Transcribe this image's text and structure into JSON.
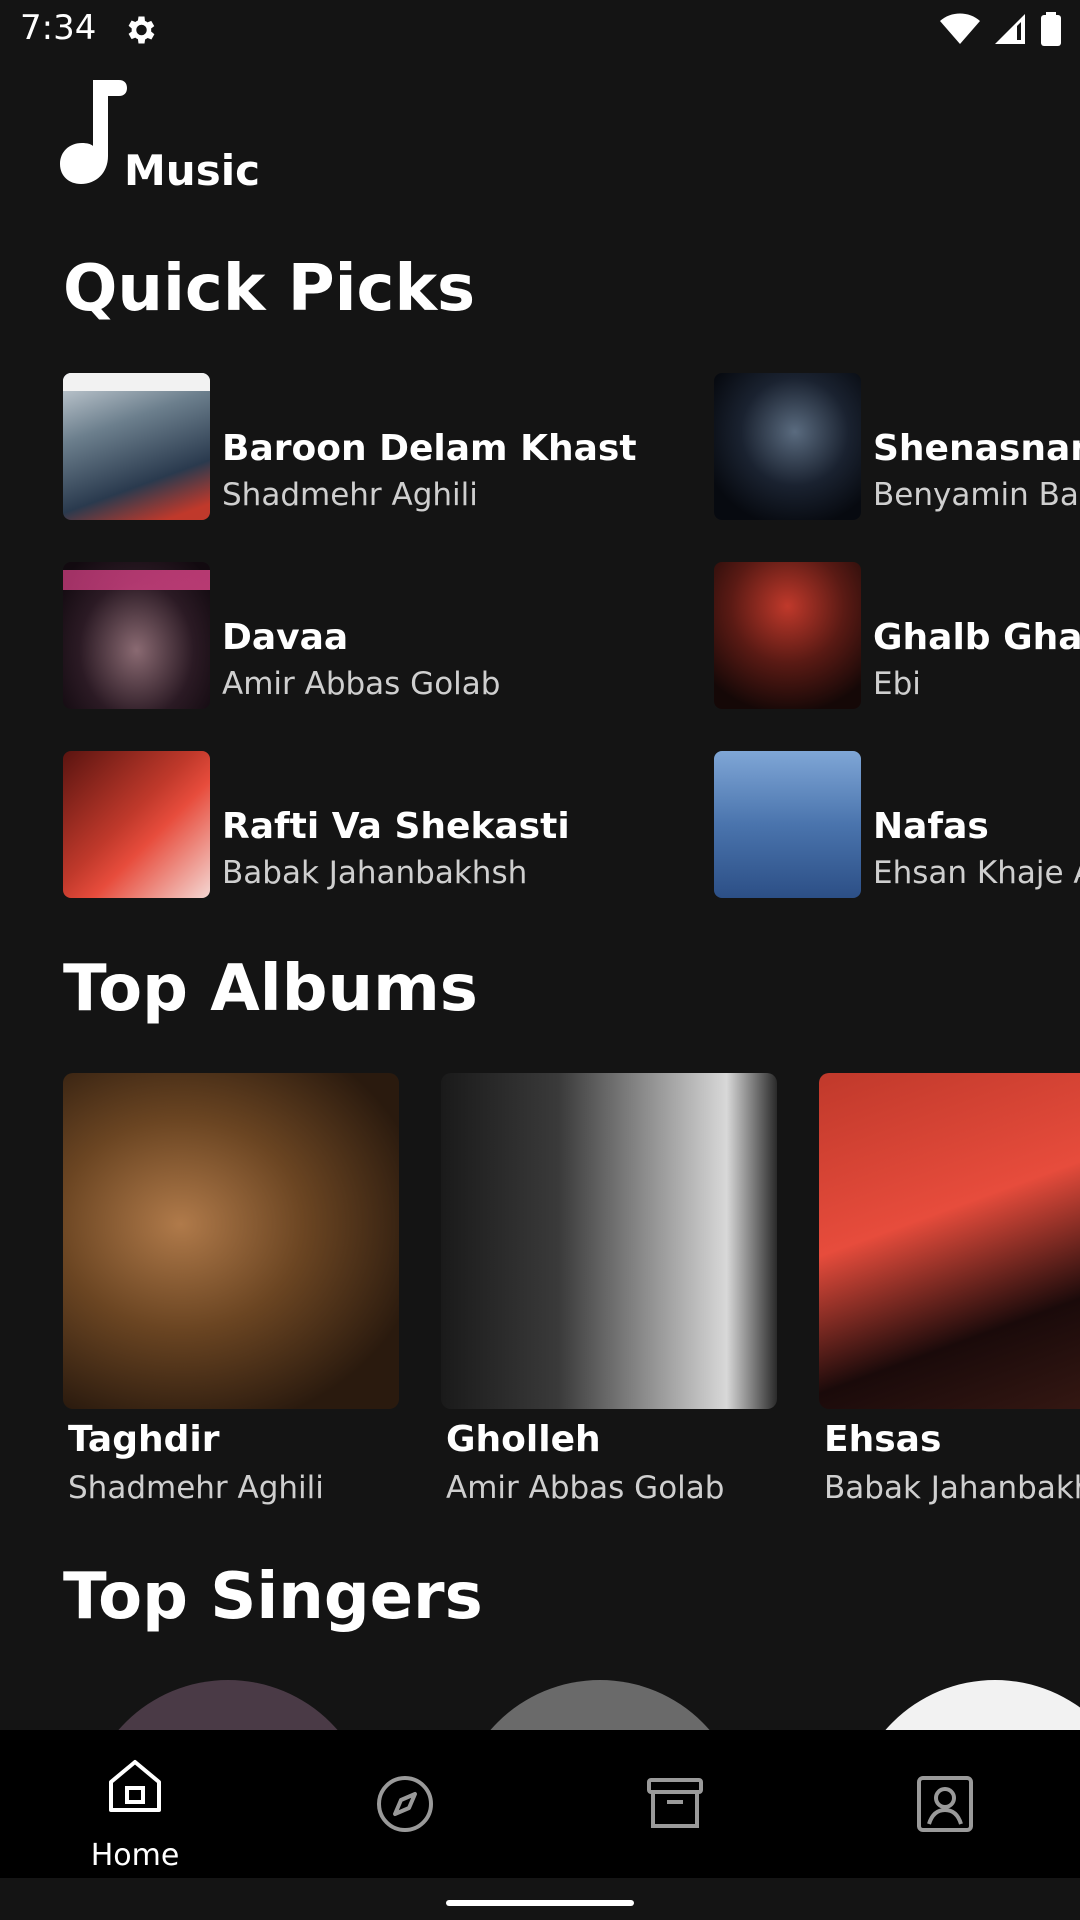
{
  "status_bar": {
    "time": "7:34",
    "icons": [
      "gear-icon",
      "wifi-icon",
      "signal-icon",
      "battery-icon"
    ]
  },
  "app": {
    "logo_icon": "music-note-icon",
    "logo_text": "Music"
  },
  "quick_picks": {
    "title": "Quick Picks",
    "items": [
      {
        "title": "Baroon Delam Khast",
        "artist": "Shadmehr Aghili"
      },
      {
        "title": "Shenasname",
        "artist": "Benyamin Bah"
      },
      {
        "title": "Davaa",
        "artist": "Amir Abbas Golab"
      },
      {
        "title": "Ghalb Ghap",
        "artist": "Ebi"
      },
      {
        "title": "Rafti Va Shekasti",
        "artist": "Babak Jahanbakhsh"
      },
      {
        "title": "Nafas",
        "artist": "Ehsan Khaje A"
      }
    ]
  },
  "top_albums": {
    "title": "Top Albums",
    "items": [
      {
        "title": "Taghdir",
        "artist": "Shadmehr Aghili"
      },
      {
        "title": "Gholleh",
        "artist": "Amir Abbas Golab"
      },
      {
        "title": "Ehsas",
        "artist": "Babak Jahanbakh"
      }
    ]
  },
  "top_singers": {
    "title": "Top Singers"
  },
  "bottom_nav": {
    "items": [
      {
        "icon": "home-icon",
        "label": "Home",
        "active": true
      },
      {
        "icon": "compass-icon",
        "label": "",
        "active": false
      },
      {
        "icon": "archive-icon",
        "label": "",
        "active": false
      },
      {
        "icon": "profile-icon",
        "label": "",
        "active": false
      }
    ]
  },
  "colors": {
    "background": "#141414",
    "nav_background": "#000000",
    "primary_text": "#ffffff",
    "secondary_text": "#cfcfcf"
  }
}
